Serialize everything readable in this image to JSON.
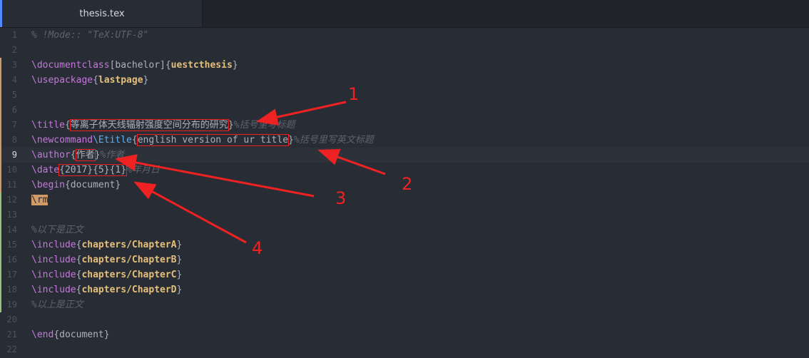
{
  "tab": {
    "title": "thesis.tex"
  },
  "lines": [
    {
      "n": "1",
      "parts": [
        {
          "c": "cmt",
          "t": "% !Mode:: \"TeX:UTF-8\""
        }
      ]
    },
    {
      "n": "2",
      "parts": []
    },
    {
      "n": "3",
      "parts": [
        {
          "c": "kw",
          "t": "\\documentclass"
        },
        {
          "c": "plain",
          "t": "[bachelor]{"
        },
        {
          "c": "arg",
          "t": "uestcthesis"
        },
        {
          "c": "plain",
          "t": "}"
        }
      ]
    },
    {
      "n": "4",
      "parts": [
        {
          "c": "kw",
          "t": "\\usepackage"
        },
        {
          "c": "plain",
          "t": "{"
        },
        {
          "c": "arg",
          "t": "lastpage"
        },
        {
          "c": "plain",
          "t": "}"
        }
      ]
    },
    {
      "n": "5",
      "parts": []
    },
    {
      "n": "6",
      "parts": []
    },
    {
      "n": "7",
      "parts": [
        {
          "c": "kw",
          "t": "\\title"
        },
        {
          "c": "plain",
          "t": "{"
        },
        {
          "c": "plain box",
          "t": "等离子体天线辐射强度空间分布的研究"
        },
        {
          "c": "plain",
          "t": "}"
        },
        {
          "c": "cmt",
          "t": "%括号里写标题"
        }
      ]
    },
    {
      "n": "8",
      "parts": [
        {
          "c": "kw",
          "t": "\\newcommand"
        },
        {
          "c": "cls",
          "t": "\\Etitle"
        },
        {
          "c": "plain",
          "t": "{"
        },
        {
          "c": "plain box",
          "t": "english version of ur title"
        },
        {
          "c": "plain",
          "t": "}"
        },
        {
          "c": "cmt",
          "t": "%括号里写英文标题"
        }
      ]
    },
    {
      "n": "9",
      "parts": [
        {
          "c": "kw",
          "t": "\\author"
        },
        {
          "c": "plain",
          "t": "{"
        },
        {
          "c": "plain box",
          "t": "作者"
        },
        {
          "c": "plain",
          "t": "}"
        },
        {
          "c": "cmt",
          "t": "%作者"
        }
      ]
    },
    {
      "n": "10",
      "parts": [
        {
          "c": "kw",
          "t": "\\date"
        },
        {
          "c": "plain box",
          "t": "{2017}{5}{1}"
        },
        {
          "c": "cmt",
          "t": "%年月日"
        }
      ]
    },
    {
      "n": "11",
      "parts": [
        {
          "c": "kw",
          "t": "\\begin"
        },
        {
          "c": "plain",
          "t": "{document}"
        }
      ]
    },
    {
      "n": "12",
      "parts": [
        {
          "c": "rm",
          "t": "\\rm"
        }
      ]
    },
    {
      "n": "13",
      "parts": []
    },
    {
      "n": "14",
      "parts": [
        {
          "c": "cmt",
          "t": "%以下是正文"
        }
      ]
    },
    {
      "n": "15",
      "parts": [
        {
          "c": "kw",
          "t": "\\include"
        },
        {
          "c": "plain",
          "t": "{"
        },
        {
          "c": "arg",
          "t": "chapters/ChapterA"
        },
        {
          "c": "plain",
          "t": "}"
        }
      ]
    },
    {
      "n": "16",
      "parts": [
        {
          "c": "kw",
          "t": "\\include"
        },
        {
          "c": "plain",
          "t": "{"
        },
        {
          "c": "arg",
          "t": "chapters/ChapterB"
        },
        {
          "c": "plain",
          "t": "}"
        }
      ]
    },
    {
      "n": "17",
      "parts": [
        {
          "c": "kw",
          "t": "\\include"
        },
        {
          "c": "plain",
          "t": "{"
        },
        {
          "c": "arg",
          "t": "chapters/ChapterC"
        },
        {
          "c": "plain",
          "t": "}"
        }
      ]
    },
    {
      "n": "18",
      "parts": [
        {
          "c": "kw",
          "t": "\\include"
        },
        {
          "c": "plain",
          "t": "{"
        },
        {
          "c": "arg",
          "t": "chapters/ChapterD"
        },
        {
          "c": "plain",
          "t": "}"
        }
      ]
    },
    {
      "n": "19",
      "parts": [
        {
          "c": "cmt",
          "t": "%以上是正文"
        }
      ]
    },
    {
      "n": "20",
      "parts": []
    },
    {
      "n": "21",
      "parts": [
        {
          "c": "kw",
          "t": "\\end"
        },
        {
          "c": "plain",
          "t": "{document}"
        }
      ]
    },
    {
      "n": "22",
      "parts": []
    }
  ],
  "cursor_line": "9",
  "gutter_marks": {
    "modified": "#d19a66",
    "added": "#98c379"
  },
  "annotations": {
    "label_1": "1",
    "label_2": "2",
    "label_3": "3",
    "label_4": "4",
    "color": "#ee2222"
  }
}
